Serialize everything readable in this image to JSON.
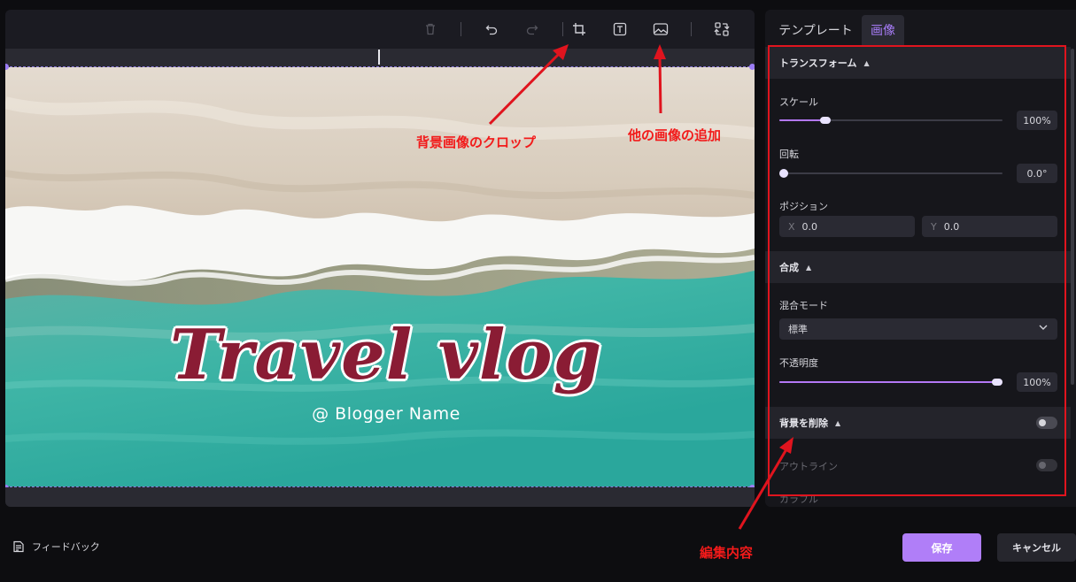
{
  "toolbar": {
    "items": [
      "delete-icon",
      "undo-icon",
      "redo-icon",
      "crop-icon",
      "text-icon",
      "image-icon",
      "replace-icon"
    ]
  },
  "canvas": {
    "title": "Travel vlog",
    "subtitle": "@ Blogger Name"
  },
  "tabs": [
    {
      "label": "テンプレート"
    },
    {
      "label": "画像"
    }
  ],
  "panel": {
    "transform": {
      "header": "トランスフォーム",
      "scale_label": "スケール",
      "scale_value": "100%",
      "scale_level": 0.2,
      "rotate_label": "回転",
      "rotate_value": "0.0°",
      "rotate_level": 0.0,
      "position_label": "ポジション",
      "x_axis": "X",
      "x_value": "0.0",
      "y_axis": "Y",
      "y_value": "0.0"
    },
    "composite": {
      "header": "合成",
      "blend_label": "混合モード",
      "blend_value": "標準",
      "opacity_label": "不透明度",
      "opacity_value": "100%",
      "opacity_level": 1.0
    },
    "remove_bg": {
      "header": "背景を削除",
      "outline_label": "アウトライン",
      "color_label": "カラフル"
    }
  },
  "footer": {
    "feedback_label": "フィードバック",
    "save_label": "保存",
    "cancel_label": "キャンセル"
  },
  "annotations": {
    "crop_note": "背景画像のクロップ",
    "add_image_note": "他の画像の追加",
    "edit_note": "編集内容"
  },
  "colors": {
    "accent": "#b07ef8",
    "annotation": "#e0141e",
    "title_text": "#8a1c34"
  }
}
